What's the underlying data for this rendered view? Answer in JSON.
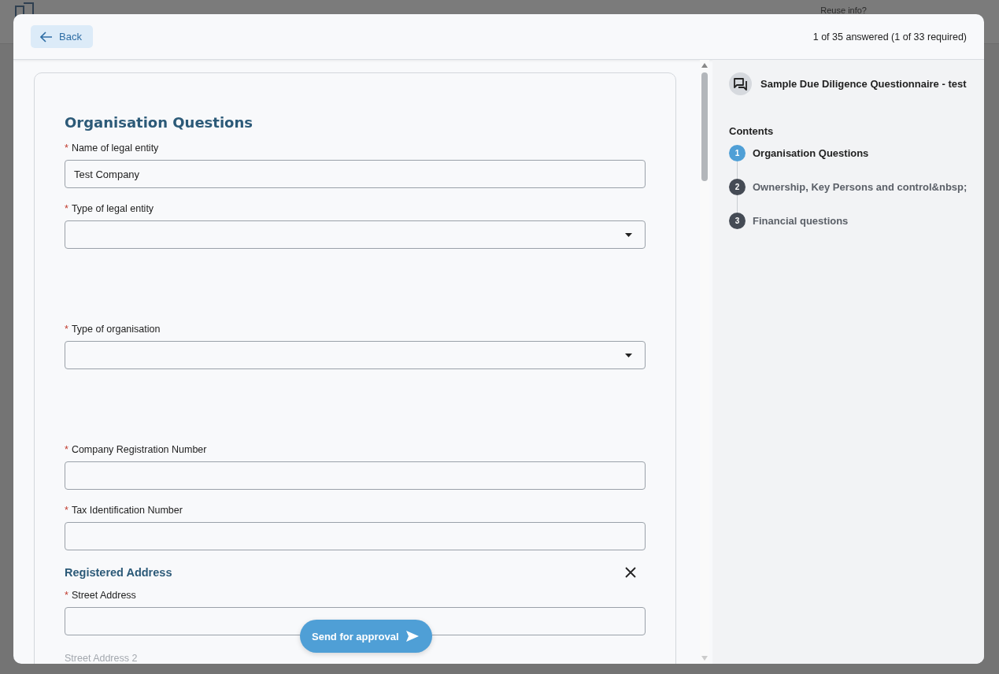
{
  "background": {
    "reuse_link": "Reuse info?"
  },
  "header": {
    "back_label": "Back",
    "progress": "1 of 35 answered (1 of 33 required)"
  },
  "required_marker": "*",
  "sections": [
    {
      "title": "Organisation Questions",
      "kind": "main",
      "fields": [
        {
          "label": "Name of legal entity",
          "required": true,
          "kind": "text",
          "value": "Test Company"
        },
        {
          "label": "Type of legal entity",
          "required": true,
          "kind": "select"
        },
        {
          "label": "Type of organisation",
          "required": true,
          "kind": "select"
        },
        {
          "label": "Company Registration Number",
          "required": true,
          "kind": "text"
        },
        {
          "label": "Tax Identification Number",
          "required": true,
          "kind": "text"
        }
      ]
    },
    {
      "title": "Registered Address",
      "kind": "sub",
      "fields": [
        {
          "label": "Street Address",
          "required": true,
          "kind": "text"
        },
        {
          "label": "Street Address 2",
          "required": false,
          "kind": "label"
        }
      ]
    }
  ],
  "send_label": "Send for approval",
  "sidebar": {
    "title": "Sample Due Diligence Questionnaire - test",
    "contents_label": "Contents",
    "steps": [
      {
        "number": "1",
        "label": "Organisation Questions",
        "selected": true
      },
      {
        "number": "2",
        "label": "Ownership, Key Persons and control&nbsp;",
        "selected": false
      },
      {
        "number": "3",
        "label": "Financial questions",
        "selected": false
      }
    ]
  }
}
